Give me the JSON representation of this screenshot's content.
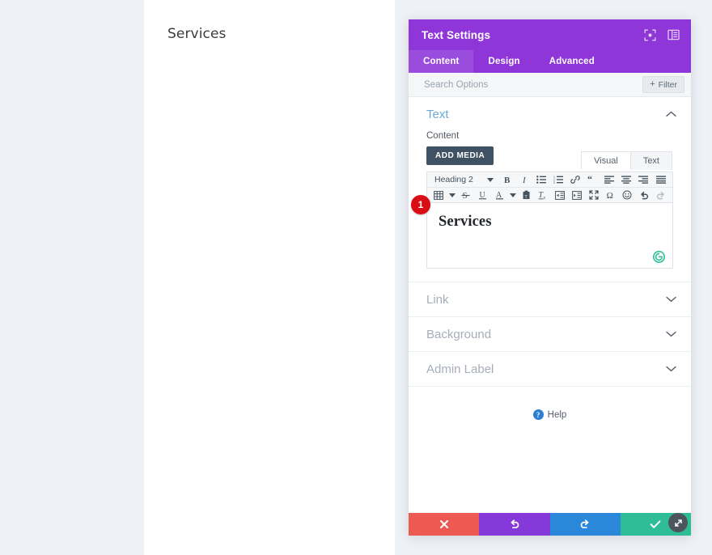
{
  "site": {
    "heading": "Services"
  },
  "modal": {
    "title": "Text Settings",
    "header_icons": [
      {
        "name": "expand-icon"
      },
      {
        "name": "dock-layout-icon"
      }
    ],
    "tabs": [
      {
        "label": "Content",
        "active": true
      },
      {
        "label": "Design",
        "active": false
      },
      {
        "label": "Advanced",
        "active": false
      }
    ],
    "search": {
      "placeholder": "Search Options",
      "value": ""
    },
    "filter_button": {
      "label": "Filter",
      "plus": "+"
    },
    "sections": [
      {
        "title": "Text",
        "open": true,
        "chevron": "up"
      },
      {
        "title": "Link",
        "open": false,
        "chevron": "down"
      },
      {
        "title": "Background",
        "open": false,
        "chevron": "down"
      },
      {
        "title": "Admin Label",
        "open": false,
        "chevron": "down"
      }
    ],
    "content_field": {
      "label": "Content",
      "add_media_label": "ADD MEDIA",
      "editor_tabs": [
        {
          "label": "Visual",
          "active": true
        },
        {
          "label": "Text",
          "active": false
        }
      ],
      "format_select": "Heading 2",
      "toolbar_row1": [
        "bold-icon",
        "italic-icon",
        "bulleted-list-icon",
        "numbered-list-icon",
        "link-icon",
        "blockquote-icon",
        "align-left-icon",
        "align-center-icon",
        "align-right-icon",
        "align-justify-icon"
      ],
      "toolbar_row2": [
        "table-icon",
        "strikethrough-icon",
        "underline-icon",
        "text-color-icon",
        "paste-as-text-icon",
        "clear-formatting-icon",
        "outdent-icon",
        "indent-icon",
        "fullscreen-icon",
        "special-character-icon",
        "emoji-icon",
        "undo-icon",
        "redo-icon"
      ],
      "editor_text": "Services",
      "grammarly_letter": "G",
      "badge": "1"
    },
    "help": {
      "label": "Help",
      "icon_glyph": "?"
    },
    "footer_buttons": [
      {
        "name": "cancel-button",
        "icon": "close-icon"
      },
      {
        "name": "undo-button",
        "icon": "undo-icon"
      },
      {
        "name": "redo-button",
        "icon": "redo-icon"
      },
      {
        "name": "save-button",
        "icon": "check-icon"
      }
    ],
    "resize_handle": {
      "name": "resize-handle-icon"
    }
  },
  "colors": {
    "brand_purple": "#8f36d9",
    "tab_active": "#9a4ddd",
    "cancel_red": "#ec5a52",
    "undo_purple": "#8639d9",
    "redo_blue": "#2b87d9",
    "save_green": "#2ebd97",
    "badge_red": "#d90d13",
    "grammarly_green": "#2ebd97",
    "section_open_blue": "#6ca9d6",
    "page_bg": "#eef2f7"
  }
}
